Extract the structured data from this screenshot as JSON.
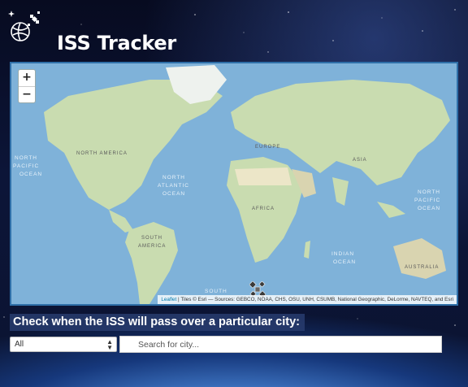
{
  "app": {
    "title": "ISS Tracker",
    "logo_icon": "globe-satellite-icon"
  },
  "map": {
    "zoom_in_label": "+",
    "zoom_out_label": "−",
    "attribution_link": "Leaflet",
    "attribution_text": "| Tiles © Esri — Sources: GEBCO, NOAA, CHS, OSU, UNH, CSUMB, National Geographic, DeLorme, NAVTEQ, and Esri",
    "labels": {
      "north_america": "NORTH AMERICA",
      "north_pacific_1": "NORTH",
      "north_pacific_2": "PACIFIC",
      "north_pacific_3": "OCEAN",
      "north_atlantic_1": "NORTH",
      "north_atlantic_2": "ATLANTIC",
      "north_atlantic_3": "OCEAN",
      "south_america_1": "SOUTH",
      "south_america_2": "AMERICA",
      "south_atlantic": "SOUTH",
      "africa": "AFRICA",
      "europe": "EUROPE",
      "asia": "ASIA",
      "indian_ocean_1": "INDIAN",
      "indian_ocean_2": "OCEAN",
      "australia": "AUSTRALIA",
      "north_pacific_east_1": "NORTH",
      "north_pacific_east_2": "PACIFIC",
      "north_pacific_east_3": "OCEAN"
    },
    "marker_icon": "iss-satellite-icon"
  },
  "pass_check": {
    "heading": "Check when the ISS will pass over a particular city:",
    "select_value": "All",
    "search_placeholder": "Search for city..."
  },
  "colors": {
    "ocean": "#7fb2d9",
    "land": "#c9dcb0",
    "accent_border": "#2f6fa8"
  }
}
